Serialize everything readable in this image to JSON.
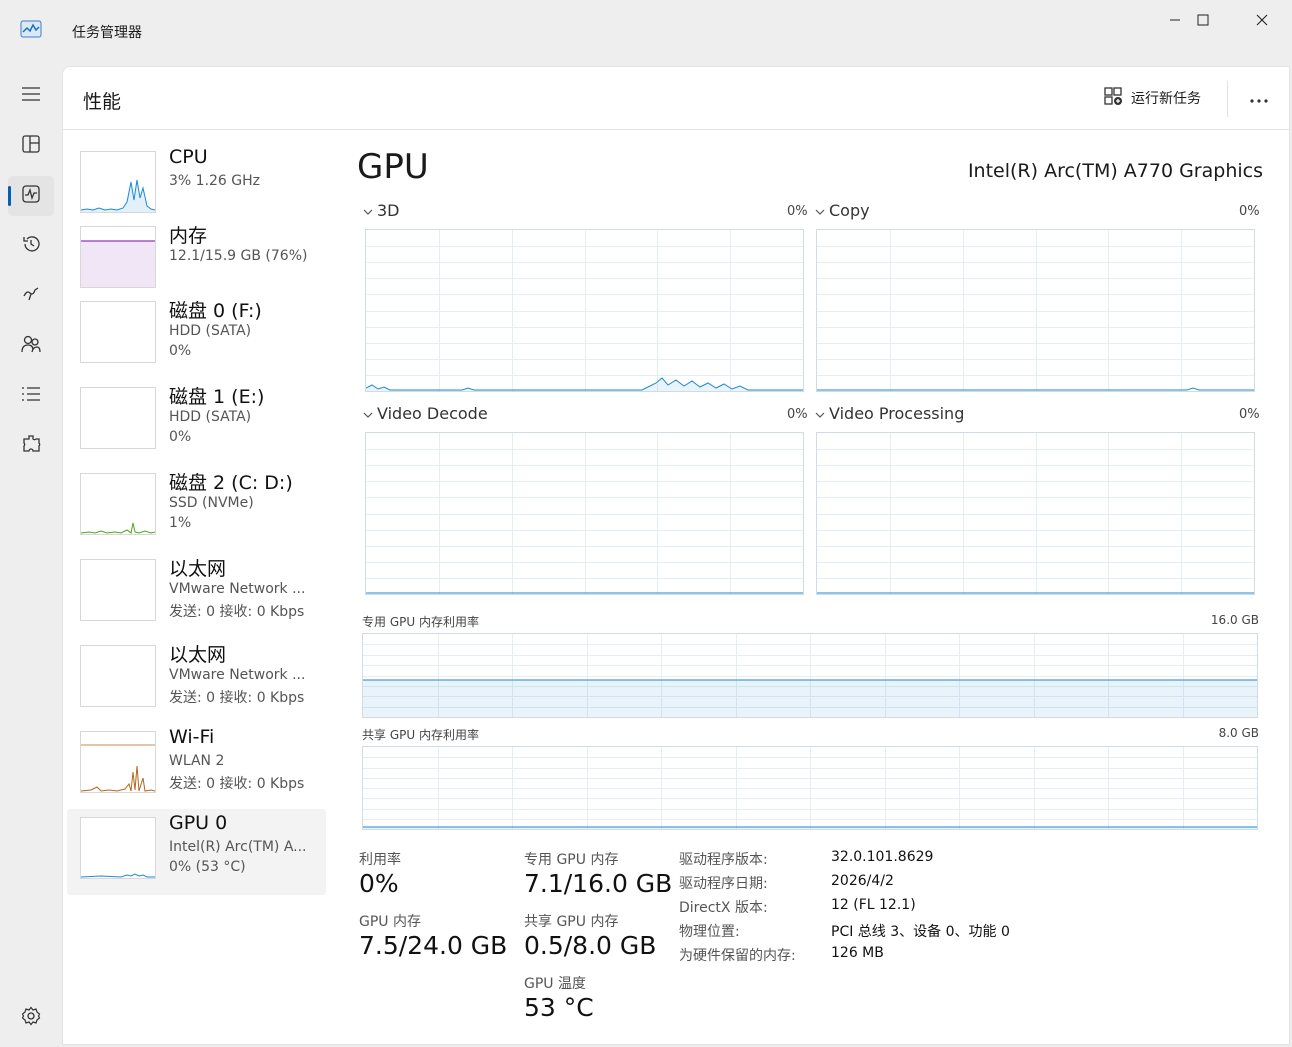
{
  "app": {
    "title": "任务管理器"
  },
  "header": {
    "title": "性能",
    "run_task_label": "运行新任务"
  },
  "colors": {
    "accent": "#005fb8",
    "cpu": "#1b8ad6",
    "memory": "#8e3bb5",
    "disk": "#4ca519",
    "wifi": "#b5651d",
    "gpu": "#1f8ad0"
  },
  "nav": [
    "menu-icon",
    "processes-icon",
    "performance-icon",
    "app-history-icon",
    "startup-icon",
    "users-icon",
    "details-icon",
    "services-icon",
    "settings-icon"
  ],
  "devices": [
    {
      "name": "CPU",
      "line1": "3% 1.26 GHz",
      "line2": ""
    },
    {
      "name": "内存",
      "line1": "12.1/15.9 GB (76%)",
      "line2": ""
    },
    {
      "name": "磁盘 0 (F:)",
      "line1": "HDD (SATA)",
      "line2": "0%"
    },
    {
      "name": "磁盘 1 (E:)",
      "line1": "HDD (SATA)",
      "line2": "0%"
    },
    {
      "name": "磁盘 2 (C: D:)",
      "line1": "SSD (NVMe)",
      "line2": "1%"
    },
    {
      "name": "以太网",
      "line1": "VMware Network ...",
      "line2": "发送: 0 接收: 0 Kbps"
    },
    {
      "name": "以太网",
      "line1": "VMware Network ...",
      "line2": "发送: 0 接收: 0 Kbps"
    },
    {
      "name": "Wi-Fi",
      "line1": "WLAN 2",
      "line2": "发送: 0 接收: 0 Kbps"
    },
    {
      "name": "GPU 0",
      "line1": "Intel(R) Arc(TM) A...",
      "line2": "0% (53 °C)"
    }
  ],
  "gpu": {
    "title": "GPU",
    "model": "Intel(R) Arc(TM) A770 Graphics",
    "engines": [
      {
        "label": "3D",
        "pct": "0%"
      },
      {
        "label": "Copy",
        "pct": "0%"
      },
      {
        "label": "Video Decode",
        "pct": "0%"
      },
      {
        "label": "Video Processing",
        "pct": "0%"
      }
    ],
    "dedicated_label": "专用 GPU 内存利用率",
    "dedicated_max": "16.0 GB",
    "shared_label": "共享 GPU 内存利用率",
    "shared_max": "8.0 GB",
    "stats": {
      "util_label": "利用率",
      "util_value": "0%",
      "gpu_mem_label": "GPU 内存",
      "gpu_mem_value": "7.5/24.0 GB",
      "ded_label": "专用 GPU 内存",
      "ded_value": "7.1/16.0 GB",
      "shared_label": "共享 GPU 内存",
      "shared_value": "0.5/8.0 GB",
      "temp_label": "GPU 温度",
      "temp_value": "53 °C"
    },
    "info": [
      {
        "k": "驱动程序版本:",
        "v": "32.0.101.8629"
      },
      {
        "k": "驱动程序日期:",
        "v": "2026/4/2"
      },
      {
        "k": "DirectX 版本:",
        "v": "12 (FL 12.1)"
      },
      {
        "k": "物理位置:",
        "v": "PCI 总线 3、设备 0、功能 0"
      },
      {
        "k": "为硬件保留的内存:",
        "v": "126 MB"
      }
    ]
  }
}
